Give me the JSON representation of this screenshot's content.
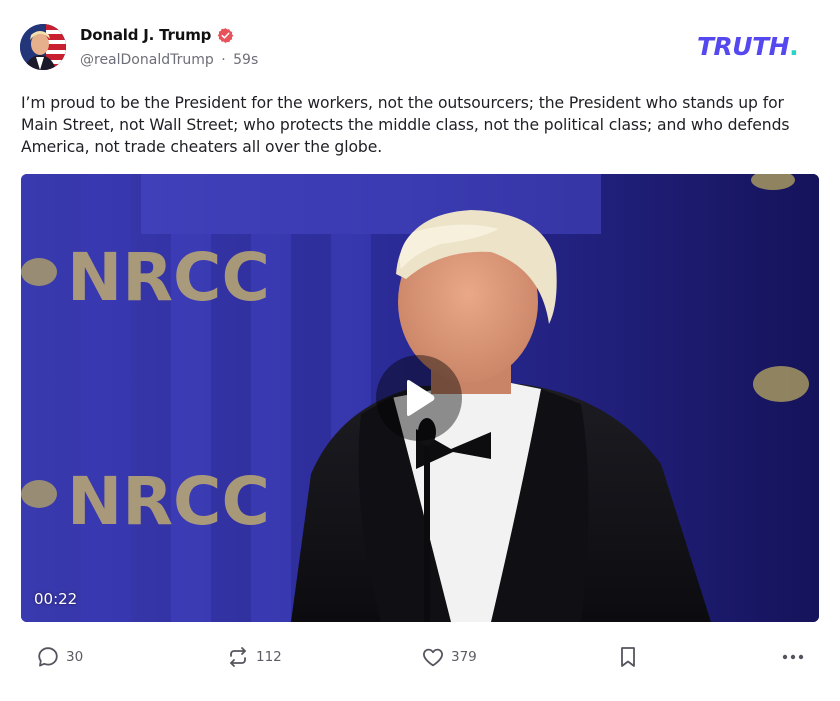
{
  "post": {
    "author": {
      "display_name": "Donald J. Trump",
      "handle": "@realDonaldTrump",
      "separator": "·",
      "timestamp": "59s",
      "verified": true,
      "verified_color": "#e8525b"
    },
    "brand": {
      "logo_text": "TRUTH",
      "logo_dot": ".",
      "primary_color": "#5448ee",
      "dot_color": "#27d4c6"
    },
    "text": "I’m proud to be the President for the workers, not the outsourcers; the President who stands up for Main Street, not Wall Street; who protects the middle class, not the political class; and who defends America, not trade cheaters all over the globe.",
    "media": {
      "type": "video",
      "duration": "00:22",
      "backdrop_text": [
        "NRCC",
        "NRCC"
      ],
      "play_icon": "play-icon"
    },
    "actions": {
      "replies": "30",
      "retruths": "112",
      "likes": "379"
    },
    "icons": {
      "reply": "comment-bubble-icon",
      "retruth": "retruth-arrows-icon",
      "like": "heart-icon",
      "bookmark": "bookmark-icon",
      "more": "ellipsis-icon"
    }
  }
}
